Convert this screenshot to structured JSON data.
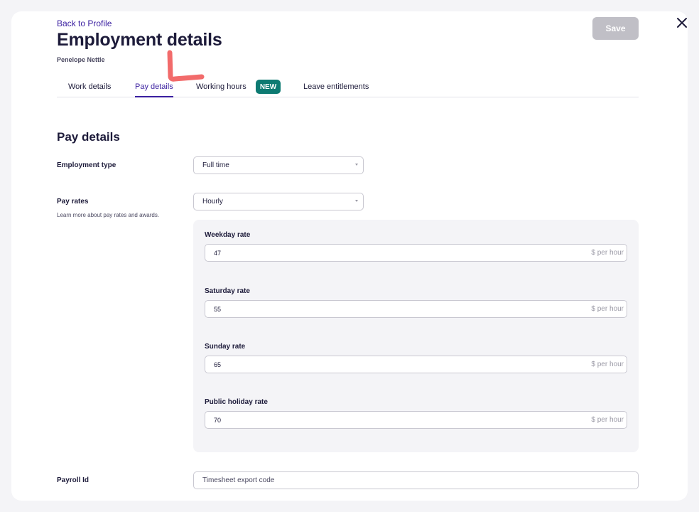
{
  "header": {
    "back_link": "Back to Profile",
    "title": "Employment details",
    "subtitle": "Penelope Nettle",
    "save_label": "Save",
    "close_icon": "close-icon"
  },
  "tabs": [
    {
      "label": "Work details",
      "active": false
    },
    {
      "label": "Pay details",
      "active": true
    },
    {
      "label": "Working hours",
      "active": false,
      "badge": "NEW"
    },
    {
      "label": "Leave entitlements",
      "active": false
    }
  ],
  "section": {
    "title": "Pay details"
  },
  "employment_type": {
    "label": "Employment type",
    "value": "Full time"
  },
  "pay_rates": {
    "label": "Pay rates",
    "helper": "Learn more about pay rates and awards.",
    "value": "Hourly",
    "unit": "$ per hour",
    "rates": [
      {
        "label": "Weekday rate",
        "value": "47"
      },
      {
        "label": "Saturday rate",
        "value": "55"
      },
      {
        "label": "Sunday rate",
        "value": "65"
      },
      {
        "label": "Public holiday rate",
        "value": "70"
      }
    ]
  },
  "payroll": {
    "label": "Payroll Id",
    "placeholder": "Timesheet export code"
  },
  "colors": {
    "accent": "#3a1fa0",
    "badge": "#0d7a72",
    "annotation": "#f26b6b",
    "disabled_button": "#c0bfc6"
  }
}
